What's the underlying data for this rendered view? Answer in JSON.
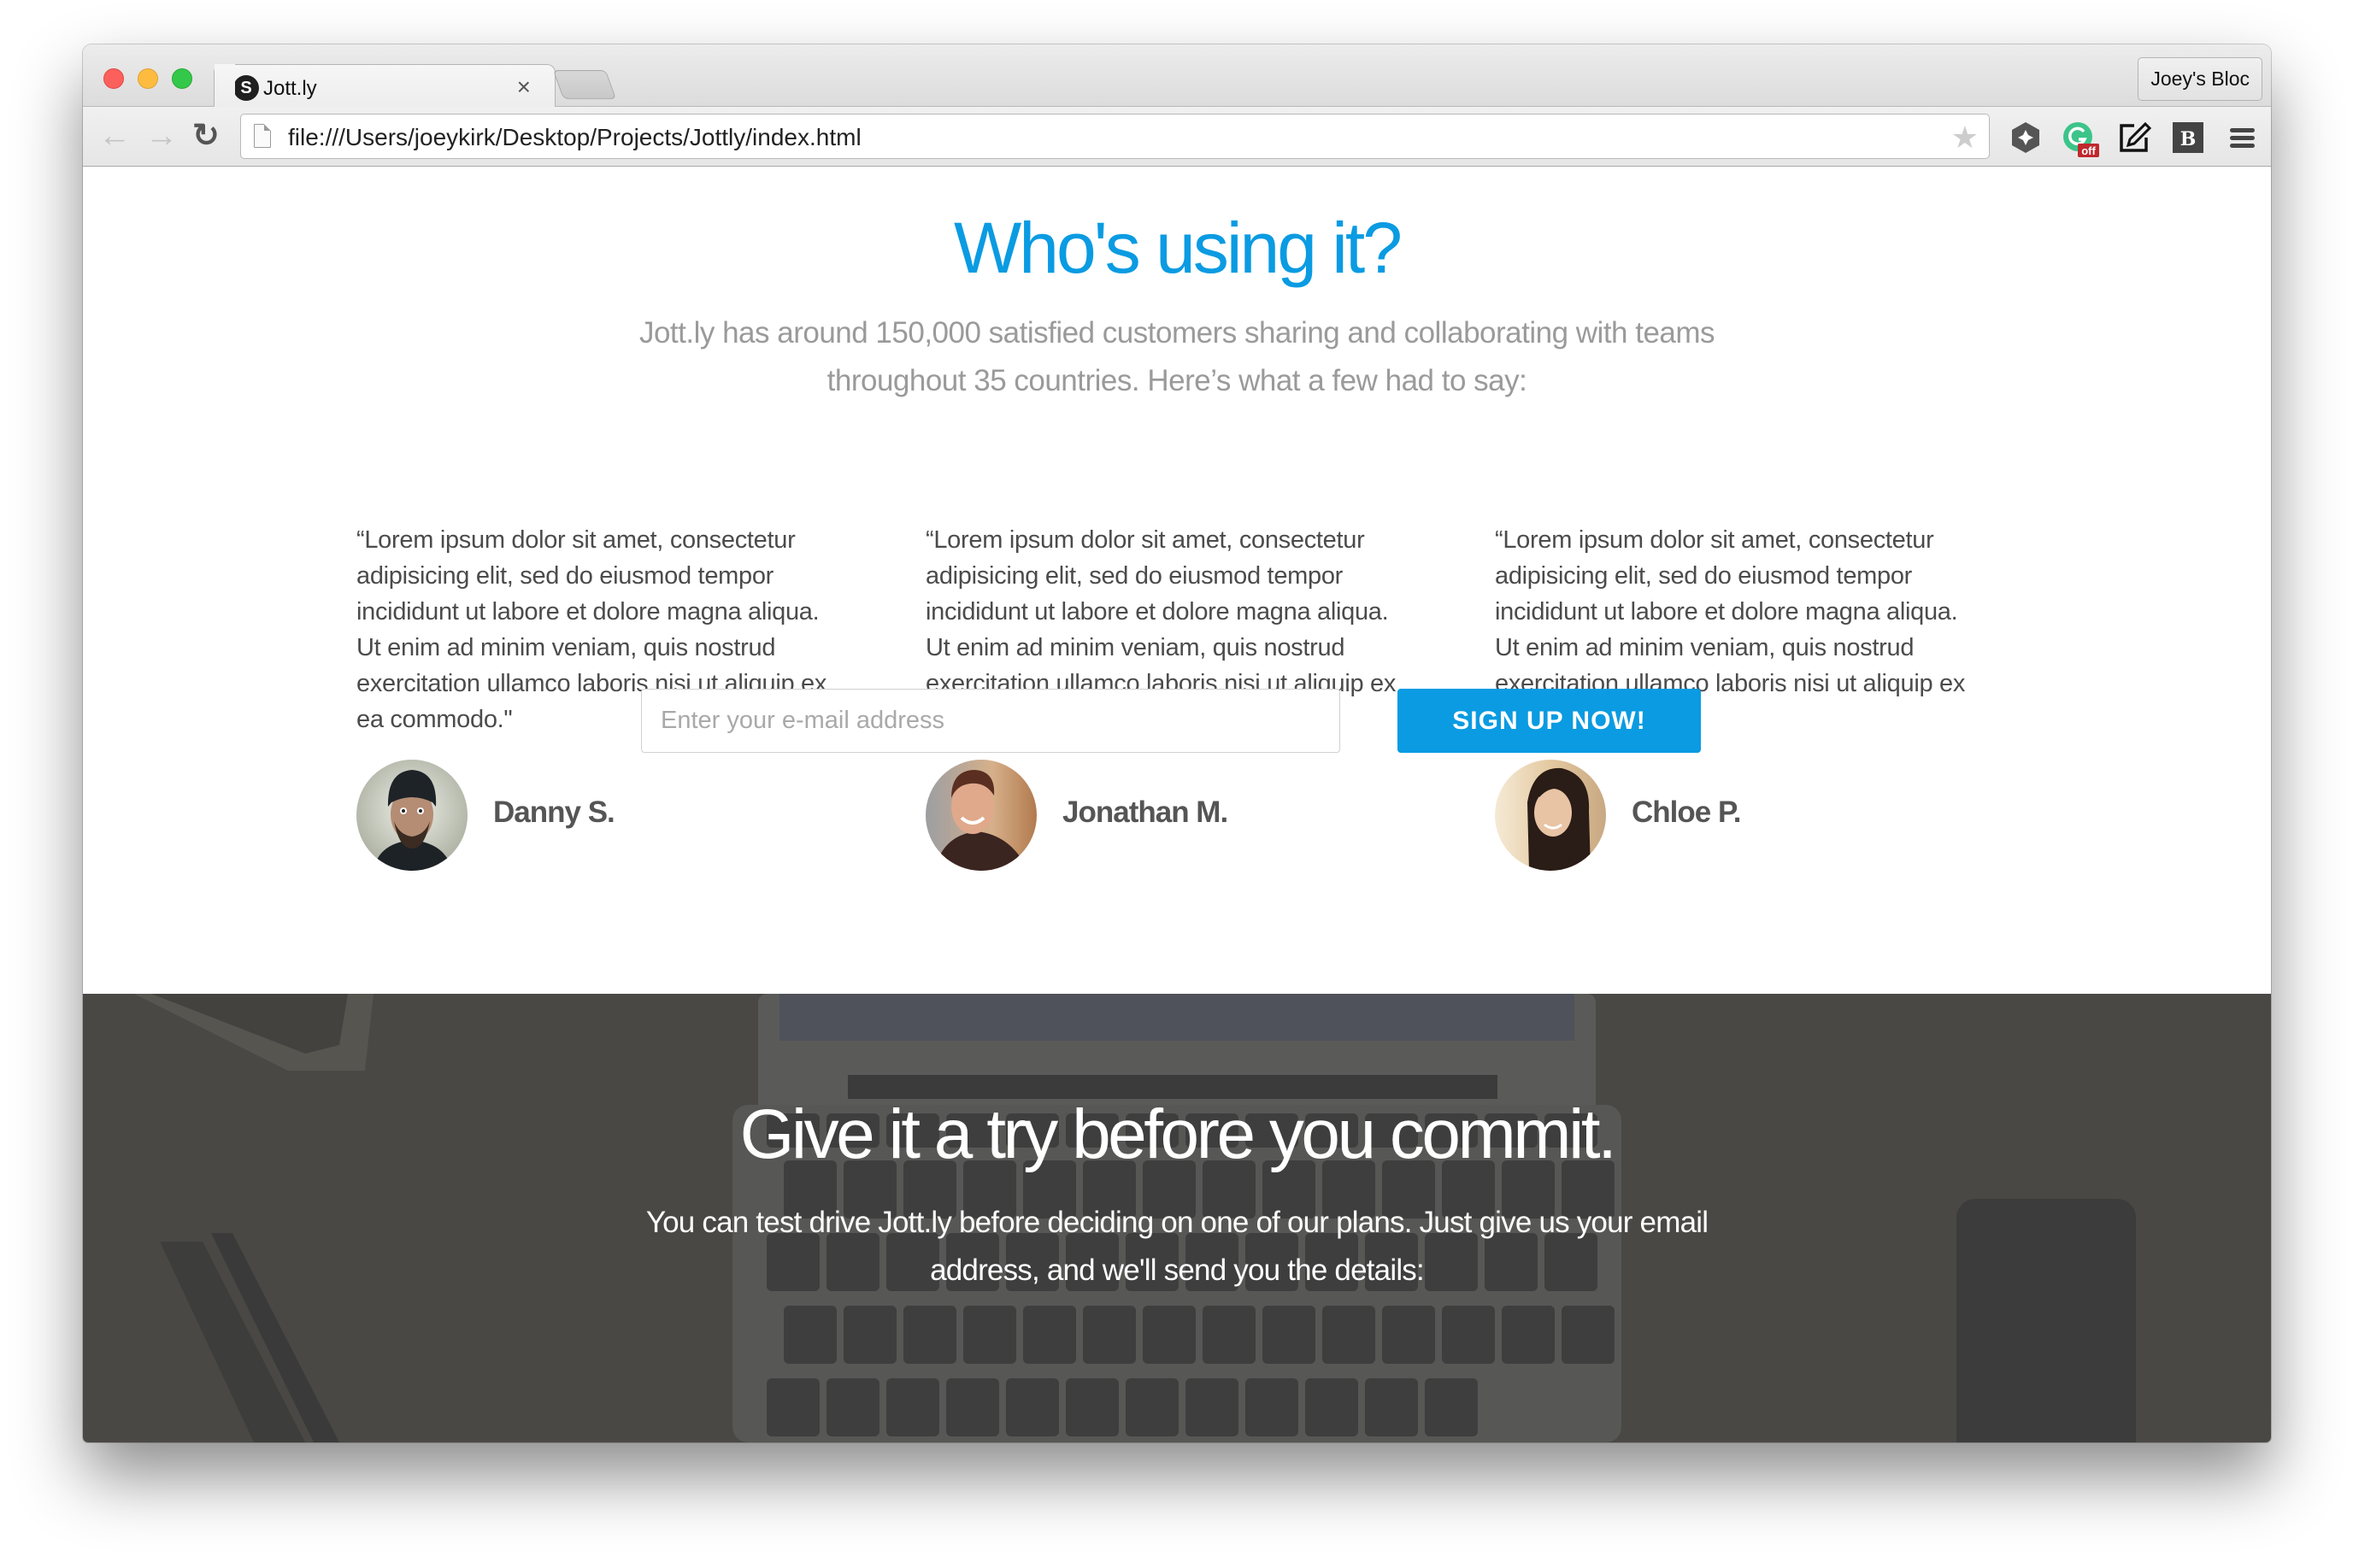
{
  "browser": {
    "tab_title": "Jott.ly",
    "tab_favicon_letter": "S",
    "tab_close": "×",
    "profile_name": "Joey's Bloc",
    "url": "file:///Users/joeykirk/Desktop/Projects/Jottly/index.html",
    "nav": {
      "back": "←",
      "forward": "→",
      "reload": "↻"
    },
    "star": "★",
    "extensions": [
      {
        "name": "hexagon-extension-icon"
      },
      {
        "name": "grammarly-icon",
        "badge": "off"
      },
      {
        "name": "edit-note-icon"
      },
      {
        "name": "bold-b-icon",
        "label": "B"
      },
      {
        "name": "menu-icon"
      }
    ]
  },
  "testimonials_section": {
    "title": "Who's using it?",
    "subtitle": "Jott.ly has around 150,000 satisfied customers sharing and collaborating with teams throughout 35 countries. Here’s what a few had to say:",
    "items": [
      {
        "quote": "“Lorem ipsum dolor sit amet, consectetur adipisicing elit, sed do eiusmod tempor incididunt ut labore et dolore magna aliqua. Ut enim ad minim veniam, quis nostrud exercitation ullamco laboris nisi ut aliquip ex ea commodo.\"",
        "name": "Danny S."
      },
      {
        "quote": "“Lorem ipsum dolor sit amet, consectetur adipisicing elit, sed do eiusmod tempor incididunt ut labore et dolore magna aliqua. Ut enim ad minim veniam, quis nostrud exercitation ullamco laboris nisi ut aliquip ex ea commodo.\"",
        "name": "Jonathan M."
      },
      {
        "quote": "“Lorem ipsum dolor sit amet, consectetur adipisicing elit, sed do eiusmod tempor incididunt ut labore et dolore magna aliqua. Ut enim ad minim veniam, quis nostrud exercitation ullamco laboris nisi ut aliquip ex ea commodo.\"",
        "name": "Chloe P."
      }
    ]
  },
  "cta_section": {
    "title": "Give it a try before you commit.",
    "subtitle": "You can test drive Jott.ly before deciding on one of our plans. Just give us your email address, and we'll send you the details:",
    "email_placeholder": "Enter your e-mail address",
    "email_value": "",
    "button_label": "SIGN UP NOW!"
  },
  "colors": {
    "accent": "#0a9be2",
    "cta_background": "#4a4844",
    "subtitle_gray": "#9a9a9a",
    "body_text": "#4b4b4b"
  }
}
